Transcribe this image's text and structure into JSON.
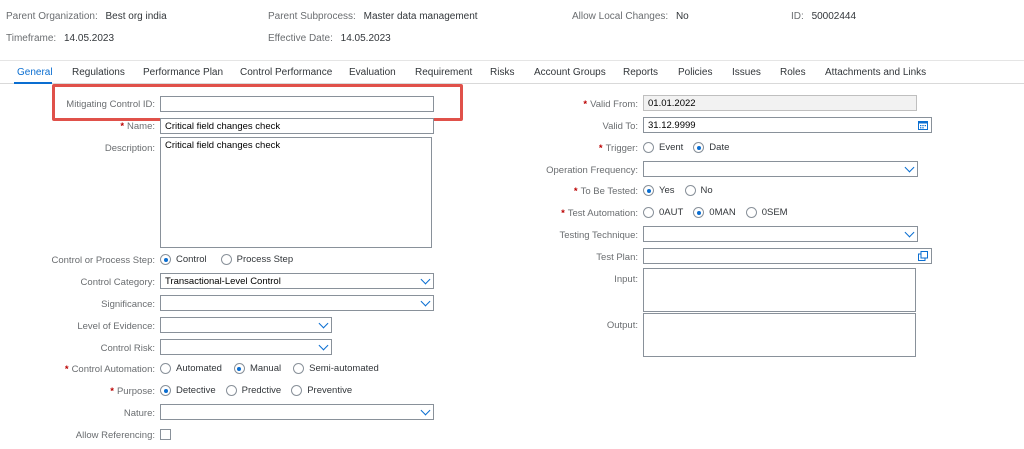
{
  "header": {
    "parent_org_label": "Parent Organization:",
    "parent_org_value": "Best org india",
    "parent_subprocess_label": "Parent Subprocess:",
    "parent_subprocess_value": "Master data management",
    "allow_local_label": "Allow Local Changes:",
    "allow_local_value": "No",
    "id_label": "ID:",
    "id_value": "50002444",
    "timeframe_label": "Timeframe:",
    "timeframe_value": "14.05.2023",
    "effective_label": "Effective Date:",
    "effective_value": "14.05.2023"
  },
  "tabs": [
    "General",
    "Regulations",
    "Performance Plan",
    "Control Performance",
    "Evaluation",
    "Requirement",
    "Risks",
    "Account Groups",
    "Reports",
    "Policies",
    "Issues",
    "Roles",
    "Attachments and Links"
  ],
  "left": {
    "mitigating_label": "Mitigating Control ID:",
    "mitigating_value": "",
    "name_label": "Name:",
    "name_value": "Critical field changes check",
    "description_label": "Description:",
    "description_value": "Critical field changes check",
    "step_label": "Control or Process Step:",
    "step_options": [
      "Control",
      "Process Step"
    ],
    "category_label": "Control Category:",
    "category_value": "Transactional-Level Control",
    "significance_label": "Significance:",
    "significance_value": "",
    "evidence_label": "Level of Evidence:",
    "evidence_value": "",
    "risk_label": "Control Risk:",
    "risk_value": "",
    "automation_label": "Control Automation:",
    "automation_options": [
      "Automated",
      "Manual",
      "Semi-automated"
    ],
    "purpose_label": "Purpose:",
    "purpose_options": [
      "Detective",
      "Predctive",
      "Preventive"
    ],
    "nature_label": "Nature:",
    "nature_value": "",
    "referencing_label": "Allow Referencing:"
  },
  "right": {
    "valid_from_label": "Valid From:",
    "valid_from_value": "01.01.2022",
    "valid_to_label": "Valid To:",
    "valid_to_value": "31.12.9999",
    "trigger_label": "Trigger:",
    "trigger_options": [
      "Event",
      "Date"
    ],
    "frequency_label": "Operation Frequency:",
    "frequency_value": "",
    "tested_label": "To Be Tested:",
    "tested_options": [
      "Yes",
      "No"
    ],
    "test_automation_label": "Test Automation:",
    "test_automation_options": [
      "0AUT",
      "0MAN",
      "0SEM"
    ],
    "technique_label": "Testing Technique:",
    "technique_value": "",
    "test_plan_label": "Test Plan:",
    "test_plan_value": "",
    "input_label": "Input:",
    "output_label": "Output:"
  },
  "colors": {
    "accent": "#0a6ed1",
    "required": "#bb0000",
    "highlight": "#e0514a"
  }
}
